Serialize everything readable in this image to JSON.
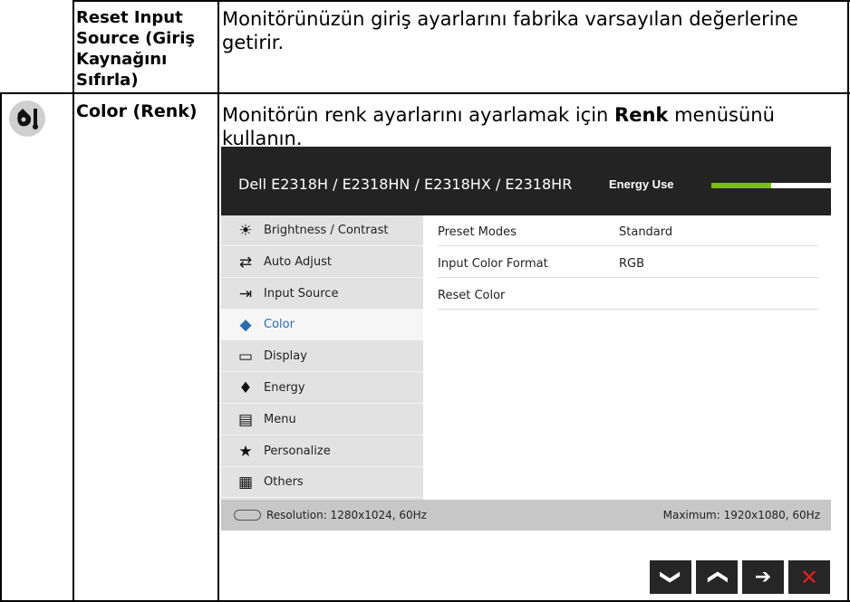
{
  "rows": [
    {
      "name": "Reset Input Source (Giriş Kaynağını Sıfırla)",
      "name_lines": [
        "Reset Input",
        "Source (Giriş",
        "Kaynağını",
        "Sıfırla)"
      ],
      "desc": "Monitörünüzün giriş ayarlarını fabrika varsayılan değerlerine getirir.",
      "desc_lines": [
        "Monitörünüzün giriş ayarlarını fabrika varsayılan değerlerine",
        "getirir."
      ]
    },
    {
      "icon": "color-icon",
      "name": "Color (Renk)",
      "desc_before": "Monitörün renk ayarlarını ayarlamak için",
      "desc_bold": "Renk",
      "desc_after": "menüsünü",
      "desc_line2": "kullanın."
    }
  ],
  "osd": {
    "title": "Dell E2318H / E2318HN / E2318HX / E2318HR",
    "energy_label": "Energy Use",
    "energy_level": 0.5,
    "colors": {
      "header": "#232323",
      "energy_fill": "#79c000",
      "selected_text": "#2a6cb0",
      "close": "#e02020"
    },
    "menu": [
      {
        "label": "Brightness / Contrast",
        "icon": "brightness-icon"
      },
      {
        "label": "Auto Adjust",
        "icon": "auto-adjust-icon"
      },
      {
        "label": "Input Source",
        "icon": "input-source-icon"
      },
      {
        "label": "Color",
        "icon": "color-icon",
        "selected": true
      },
      {
        "label": "Display",
        "icon": "display-icon"
      },
      {
        "label": "Energy",
        "icon": "energy-icon"
      },
      {
        "label": "Menu",
        "icon": "menu-icon"
      },
      {
        "label": "Personalize",
        "icon": "star-icon"
      },
      {
        "label": "Others",
        "icon": "others-icon"
      }
    ],
    "settings": [
      {
        "name": "Preset Modes",
        "value": "Standard"
      },
      {
        "name": "Input Color Format",
        "value": "RGB"
      },
      {
        "name": "Reset Color",
        "value": ""
      }
    ],
    "footer": {
      "resolution": "Resolution: 1280x1024, 60Hz",
      "maximum": "Maximum: 1920x1080, 60Hz"
    },
    "buttons": [
      {
        "name": "down-button",
        "icon": "chevron-down-icon",
        "glyph": "❯"
      },
      {
        "name": "up-button",
        "icon": "chevron-up-icon",
        "glyph": "❯"
      },
      {
        "name": "enter-button",
        "icon": "arrow-right-icon",
        "glyph": "➔"
      },
      {
        "name": "exit-button",
        "icon": "close-icon",
        "glyph": "✕"
      }
    ]
  }
}
